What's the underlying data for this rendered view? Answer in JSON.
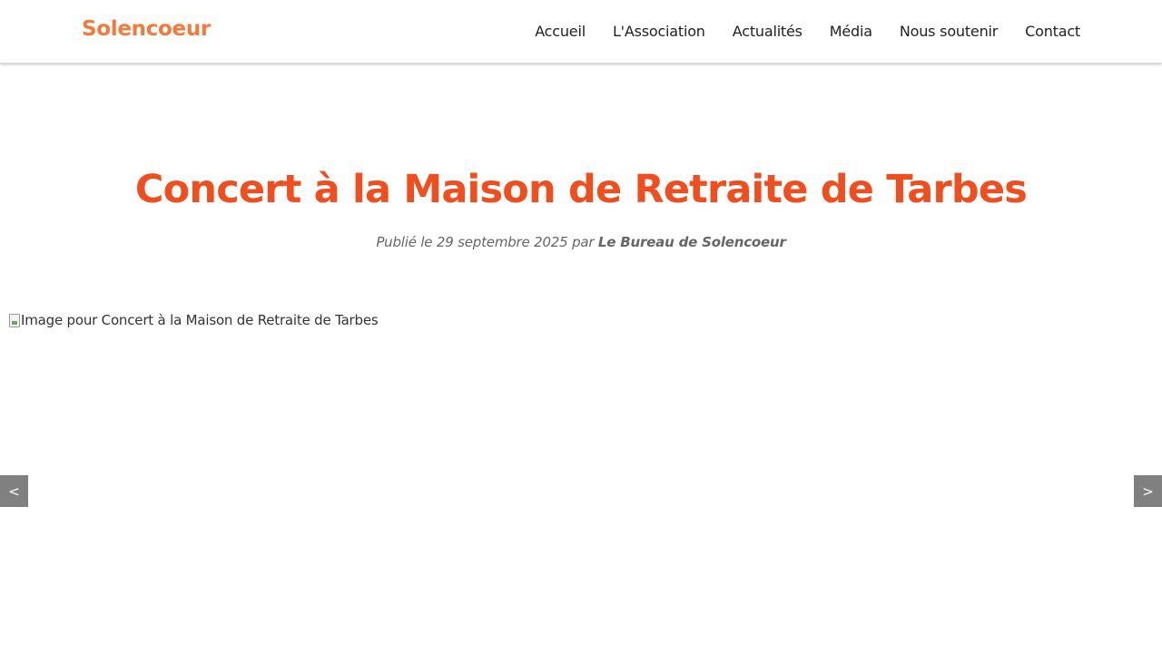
{
  "colors": {
    "brand": "#f47a3c",
    "title": "#f04e1e",
    "meta": "#666666",
    "button_bg": "#808080"
  },
  "header": {
    "logo": "Solencoeur",
    "nav": [
      "Accueil",
      "L'Association",
      "Actualités",
      "Média",
      "Nous soutenir",
      "Contact"
    ]
  },
  "article": {
    "title": "Concert à la Maison de Retraite de Tarbes",
    "meta_prefix": "Publié le 29 septembre 2025 par ",
    "author": "Le Bureau de Solencoeur",
    "image_alt": "Image pour Concert à la Maison de Retraite de Tarbes"
  },
  "slider": {
    "prev_label": "<",
    "next_label": ">"
  }
}
